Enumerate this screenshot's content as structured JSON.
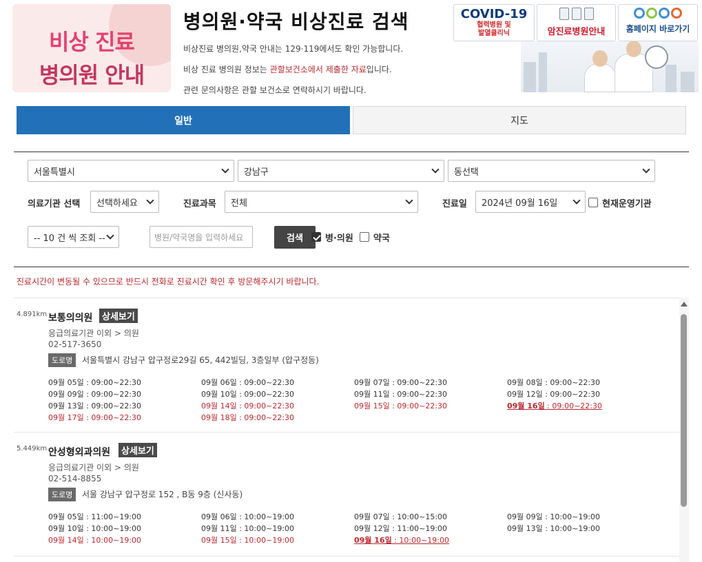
{
  "header": {
    "logo_line1": "비상 진료",
    "logo_line2": "병의원 안내",
    "title": "병의원·약국 비상진료 검색",
    "info1": "비상진료 병의원,약국 안내는 129·119에서도 확인 가능합니다.",
    "info2_pre": "비상 진료 병의원 정보는 ",
    "info2_red": "관할보건소에서 제출한 자료",
    "info2_post": "입니다.",
    "info3": "관련 문의사항은 관할 보건소로 연락하시기 바랍니다."
  },
  "banners": {
    "covid_title": "COVID-19",
    "covid_sub1": "협력병원 및",
    "covid_sub2": "발열클리닉",
    "cancer": "암진료병원안내",
    "homepage_small": "국가암정보센터",
    "homepage": "홈페이지 바로가기"
  },
  "tabs": [
    {
      "label": "일반"
    },
    {
      "label": "지도"
    }
  ],
  "form": {
    "city": "서울특별시",
    "district": "강남구",
    "dong": "동선택",
    "facility_label": "의료기관 선택",
    "facility_value": "선택하세요",
    "dept_label": "진료과목",
    "dept_value": "전체",
    "date_label": "진료일",
    "date_value": "2024년 09월 16일",
    "open_now_label": "현재운영기관",
    "page_size": "-- 10 건 씩 조회 --",
    "search_placeholder": "병원/약국명을 입력하세요",
    "search_button": "검색",
    "hospital_label": "병·의원",
    "pharmacy_label": "약국"
  },
  "notice": "진료시간이 변동될 수 있으므로 반드시 전화로 진료시간 확인 후 방문해주시기 바랍니다.",
  "results": [
    {
      "distance": "4.891km",
      "name": "보통의의원",
      "detail_label": "상세보기",
      "category": "응급의료기관 이외 > 의원",
      "phone": "02-517-3650",
      "addr_tag": "도로명",
      "address": "서울특별시 강남구 압구정로29길 65, 442빌딩, 3층일부 (압구정동)",
      "hours": [
        {
          "d": "09월 05일",
          "t": " : 09:00~22:30",
          "s": "normal"
        },
        {
          "d": "09월 06일",
          "t": " : 09:00~22:30",
          "s": "normal"
        },
        {
          "d": "09월 07일",
          "t": " : 09:00~22:30",
          "s": "normal"
        },
        {
          "d": "09월 08일",
          "t": " : 09:00~22:30",
          "s": "normal"
        },
        {
          "d": "09월 09일",
          "t": " : 09:00~22:30",
          "s": "normal"
        },
        {
          "d": "09월 10일",
          "t": " : 09:00~22:30",
          "s": "normal"
        },
        {
          "d": "09월 11일",
          "t": " : 09:00~22:30",
          "s": "normal"
        },
        {
          "d": "09월 12일",
          "t": " : 09:00~22:30",
          "s": "normal"
        },
        {
          "d": "09월 13일",
          "t": " : 09:00~22:30",
          "s": "normal"
        },
        {
          "d": "09월 14일",
          "t": " : 09:00~22:30",
          "s": "red"
        },
        {
          "d": "09월 15일",
          "t": " : 09:00~22:30",
          "s": "red"
        },
        {
          "d": "09월 16일",
          "t": " : 09:00~22:30",
          "s": "today"
        },
        {
          "d": "09월 17일",
          "t": " : 09:00~22:30",
          "s": "red"
        },
        {
          "d": "09월 18일",
          "t": " : 09:00~22:30",
          "s": "red"
        }
      ]
    },
    {
      "distance": "5.449km",
      "name": "안성형외과의원",
      "detail_label": "상세보기",
      "category": "응급의료기관 이외 > 의원",
      "phone": "02-514-8855",
      "addr_tag": "도로명",
      "address": "서울 강남구 압구정로 152 , B동 9층 (신사동)",
      "hours": [
        {
          "d": "09월 05일",
          "t": " : 11:00~19:00",
          "s": "normal"
        },
        {
          "d": "09월 06일",
          "t": " : 10:00~19:00",
          "s": "normal"
        },
        {
          "d": "09월 07일",
          "t": " : 10:00~15:00",
          "s": "normal"
        },
        {
          "d": "09월 09일",
          "t": " : 10:00~19:00",
          "s": "normal"
        },
        {
          "d": "09월 10일",
          "t": " : 10:00~19:00",
          "s": "normal"
        },
        {
          "d": "09월 11일",
          "t": " : 10:00~19:00",
          "s": "normal"
        },
        {
          "d": "09월 12일",
          "t": " : 11:00~19:00",
          "s": "normal"
        },
        {
          "d": "09월 13일",
          "t": " : 10:00~19:00",
          "s": "normal"
        },
        {
          "d": "09월 14일",
          "t": " : 10:00~19:00",
          "s": "red"
        },
        {
          "d": "09월 15일",
          "t": " : 10:00~19:00",
          "s": "red"
        },
        {
          "d": "09월 16일",
          "t": " : 10:00~19:00",
          "s": "today"
        }
      ]
    }
  ],
  "colors": {
    "primary_tab": "#2270b8",
    "alert_red": "#c0262d",
    "logo_pink": "#e4416f"
  }
}
